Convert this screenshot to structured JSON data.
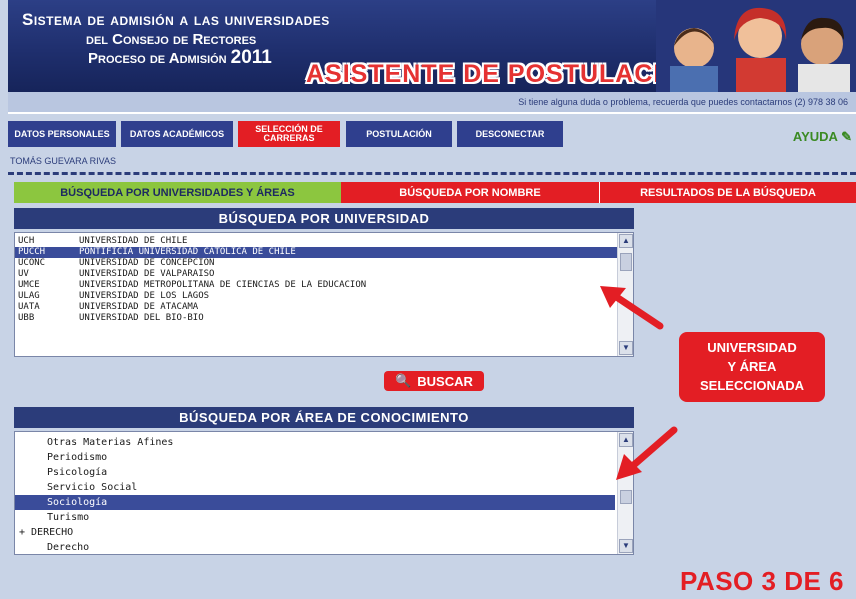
{
  "header": {
    "line1": "Sistema de admisión a las universidades",
    "line2": "del Consejo de Rectores",
    "line3": "Proceso de Admisión",
    "year": "2011",
    "assistant_title": "ASISTENTE DE POSTULACIÓN"
  },
  "infobar": {
    "text": "Si tiene alguna duda o problema, recuerda que puedes contactarnos (2) 978 38 06"
  },
  "nav": {
    "items": [
      {
        "label": "Datos Personales"
      },
      {
        "label": "Datos Académicos"
      },
      {
        "label": "Selección de Carreras"
      },
      {
        "label": "Postulación"
      },
      {
        "label": "Desconectar"
      }
    ],
    "help": "AYUDA"
  },
  "user": {
    "name": "TOMÁS GUEVARA RIVAS"
  },
  "tabs": [
    {
      "label": "Búsqueda por universidades y áreas"
    },
    {
      "label": "Búsqueda por nombre"
    },
    {
      "label": "Resultados de la búsqueda"
    }
  ],
  "university_section": {
    "title": "Búsqueda por universidad",
    "items": [
      {
        "code": "UCH",
        "name": "UNIVERSIDAD DE CHILE"
      },
      {
        "code": "PUCCH",
        "name": "PONTIFICIA UNIVERSIDAD CATOLICA DE CHILE"
      },
      {
        "code": "UCONC",
        "name": "UNIVERSIDAD DE CONCEPCION"
      },
      {
        "code": "UV",
        "name": "UNIVERSIDAD DE VALPARAISO"
      },
      {
        "code": "UMCE",
        "name": "UNIVERSIDAD METROPOLITANA DE CIENCIAS DE LA EDUCACION"
      },
      {
        "code": "ULAG",
        "name": "UNIVERSIDAD DE LOS LAGOS"
      },
      {
        "code": "UATA",
        "name": "UNIVERSIDAD DE ATACAMA"
      },
      {
        "code": "UBB",
        "name": "UNIVERSIDAD DEL BIO-BIO"
      }
    ]
  },
  "search_button": {
    "label": "BUSCAR"
  },
  "area_section": {
    "title": "Búsqueda por área de conocimiento",
    "items": [
      {
        "label": "Otras Materias Afines"
      },
      {
        "label": "Periodismo"
      },
      {
        "label": "Psicología"
      },
      {
        "label": "Servicio Social"
      },
      {
        "label": "Sociología"
      },
      {
        "label": "Turismo"
      },
      {
        "label": "+ DERECHO"
      },
      {
        "label": "Derecho"
      }
    ]
  },
  "callout": {
    "line1": "UNIVERSIDAD",
    "line2": "Y ÁREA",
    "line3": "SELECCIONADA"
  },
  "step": {
    "text": "PASO 3 DE 6"
  },
  "colors": {
    "accent_red": "#e31e24",
    "navy": "#2b3c7a",
    "green": "#8cc63f",
    "selection": "#3a4c9a"
  }
}
